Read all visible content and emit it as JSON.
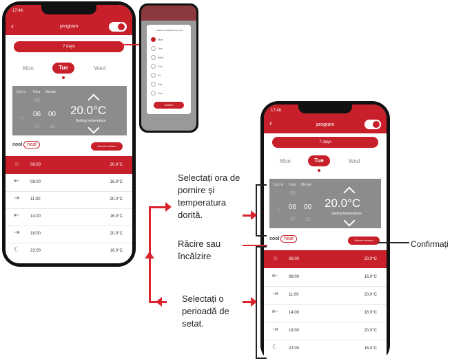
{
  "app": {
    "status_time": "17:48",
    "title": "program",
    "days_button": "7 days",
    "days": [
      "Mon",
      "Tue",
      "Wed"
    ],
    "selected_day": "Tue",
    "panel_headers": [
      "Cycl e",
      "Hour",
      "Minute"
    ],
    "hours": [
      "05",
      "06",
      "07"
    ],
    "minutes": [
      "",
      "00",
      "10"
    ],
    "temperature": "20.0°C",
    "temperature_label": "Setting temperature",
    "mode_cool": "cool",
    "mode_heat": "heat",
    "submit_label": "Submit revision",
    "schedule": [
      {
        "icon": "sun-icon",
        "time": "06:00",
        "temp": "20.0°C",
        "selected": true
      },
      {
        "icon": "door-exit-icon",
        "time": "08:00",
        "temp": "16.0°C",
        "selected": false
      },
      {
        "icon": "door-enter-icon",
        "time": "11:00",
        "temp": "20.0°C",
        "selected": false
      },
      {
        "icon": "door-exit-icon",
        "time": "14:00",
        "temp": "16.0°C",
        "selected": false
      },
      {
        "icon": "door-enter-icon",
        "time": "18:00",
        "temp": "20.0°C",
        "selected": false
      },
      {
        "icon": "moon-icon",
        "time": "22:00",
        "temp": "16.0°C",
        "selected": false
      }
    ]
  },
  "modal": {
    "title": "Select the application period",
    "days": [
      "Mon",
      "Tue",
      "Wed",
      "Thu",
      "Fri",
      "Sat",
      "Sun"
    ],
    "confirm": "confirm"
  },
  "captions": {
    "select_time": "Selectați ora de pornire și temperatura dorită.",
    "cool_heat": "Răcire sau încălzire",
    "select_period": "Selectați o perioadă de setat.",
    "confirm": "Confirmați"
  },
  "colors": {
    "accent": "#c8202a",
    "panel": "#8c8c8c"
  }
}
